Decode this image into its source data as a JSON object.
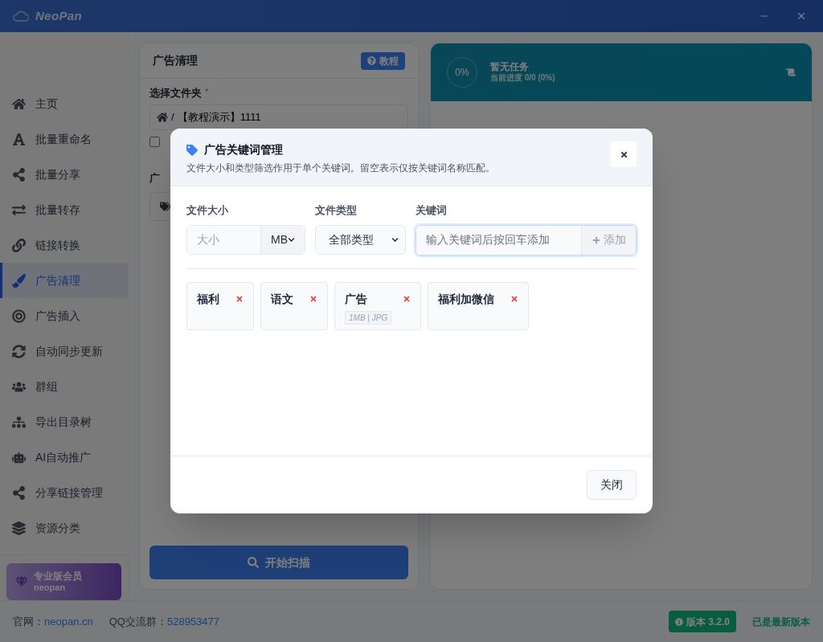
{
  "app": {
    "title": "NeoPan"
  },
  "sidebar": {
    "items": [
      {
        "label": "主页",
        "selected": false
      },
      {
        "label": "批量重命名",
        "selected": false
      },
      {
        "label": "批量分享",
        "selected": false
      },
      {
        "label": "批量转存",
        "selected": false
      },
      {
        "label": "链接转换",
        "selected": false
      },
      {
        "label": "广告清理",
        "selected": true
      },
      {
        "label": "广告插入",
        "selected": false
      },
      {
        "label": "自动同步更新",
        "selected": false
      },
      {
        "label": "群组",
        "selected": false
      },
      {
        "label": "导出目录树",
        "selected": false
      },
      {
        "label": "AI自动推广",
        "selected": false
      },
      {
        "label": "分享链接管理",
        "selected": false
      },
      {
        "label": "资源分类",
        "selected": false
      }
    ],
    "member": {
      "title": "专业版会员",
      "subtitle": "neopan"
    }
  },
  "panel": {
    "title": "广告清理",
    "tutorial_button": "教程",
    "folder_label": "选择文件夹",
    "required_mark": "*",
    "path_separator": "/",
    "path": "【教程演示】1111",
    "option_checked": false,
    "section_label": "广",
    "scan_button": "开始扫描"
  },
  "task": {
    "percent": "0%",
    "title": "暂无任务",
    "progress": "当前进度 0/0 (0%)"
  },
  "dialog": {
    "title": "广告关键词管理",
    "description": "文件大小和类型筛选作用于单个关键词。留空表示仅按关键词名称匹配。",
    "size_label": "文件大小",
    "size_placeholder": "大小",
    "size_unit": "MB",
    "type_label": "文件类型",
    "type_value": "全部类型",
    "keyword_label": "关键词",
    "keyword_placeholder": "输入关键词后按回车添加",
    "keyword_focused": true,
    "add_button": "添加",
    "keywords": [
      {
        "label": "福利"
      },
      {
        "label": "语文"
      },
      {
        "label": "广告",
        "meta": "1MB | JPG"
      },
      {
        "label": "福利加微信"
      }
    ],
    "close_button": "关闭"
  },
  "footer": {
    "site_label": "官网：",
    "site_link": "neopan.cn",
    "qq_label": "QQ交流群：",
    "qq_number": "528953477",
    "version": "版本 3.2.0",
    "update_status": "已是最新版本"
  }
}
